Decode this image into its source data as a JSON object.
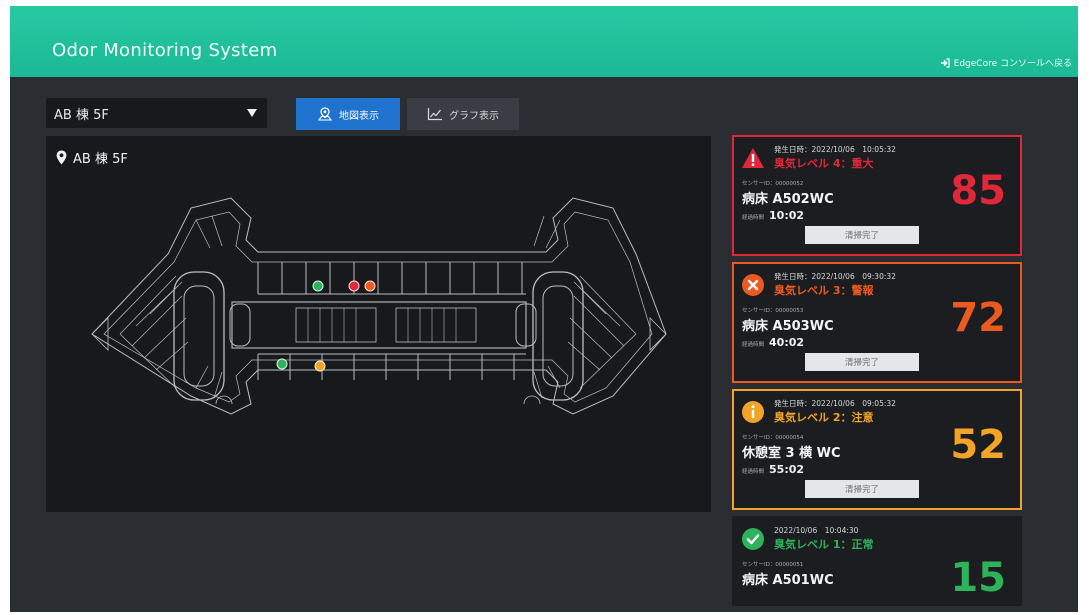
{
  "header": {
    "title": "Odor Monitoring System",
    "exit_link": "EdgeCore コンソールへ戻る"
  },
  "controls": {
    "building_select_value": "AB 棟 5F",
    "map_view_label": "地図表示",
    "graph_view_label": "グラフ表示"
  },
  "map": {
    "location_label": "AB 棟 5F",
    "sensor_markers": [
      {
        "id": "m1",
        "color": "#2eb35b",
        "status": "normal"
      },
      {
        "id": "m2",
        "color": "#e0283a",
        "status": "critical"
      },
      {
        "id": "m3",
        "color": "#ec5a22",
        "status": "warning"
      },
      {
        "id": "m4",
        "color": "#2eb35b",
        "status": "normal"
      },
      {
        "id": "m5",
        "color": "#f2a428",
        "status": "caution"
      }
    ]
  },
  "alerts": [
    {
      "date": "発生日時：2022/10/06　10:05:32",
      "level": "臭気レベル 4：重大",
      "sensor": "センサーID：00000052",
      "room": "病床 A502WC",
      "elapsed_label": "経過時間",
      "elapsed": "10:02",
      "score": "85",
      "button": "清掃完了",
      "color": "#e0283a",
      "icon": "warning-triangle-icon"
    },
    {
      "date": "発生日時：2022/10/06　09:30:32",
      "level": "臭気レベル 3：警報",
      "sensor": "センサーID：00000053",
      "room": "病床 A503WC",
      "elapsed_label": "経過時間",
      "elapsed": "40:02",
      "score": "72",
      "button": "清掃完了",
      "color": "#ec5a22",
      "icon": "x-circle-icon"
    },
    {
      "date": "発生日時：2022/10/06　09:05:32",
      "level": "臭気レベル 2：注意",
      "sensor": "センサーID：00000054",
      "room": "休憩室 3 横 WC",
      "elapsed_label": "経過時間",
      "elapsed": "55:02",
      "score": "52",
      "button": "清掃完了",
      "color": "#f2a428",
      "icon": "info-circle-icon"
    },
    {
      "date": "2022/10/06　10:04:30",
      "level": "臭気レベル 1：正常",
      "sensor": "センサーID：00000051",
      "room": "病床 A501WC",
      "score": "15",
      "color": "#2eb35b",
      "icon": "check-circle-icon"
    }
  ]
}
